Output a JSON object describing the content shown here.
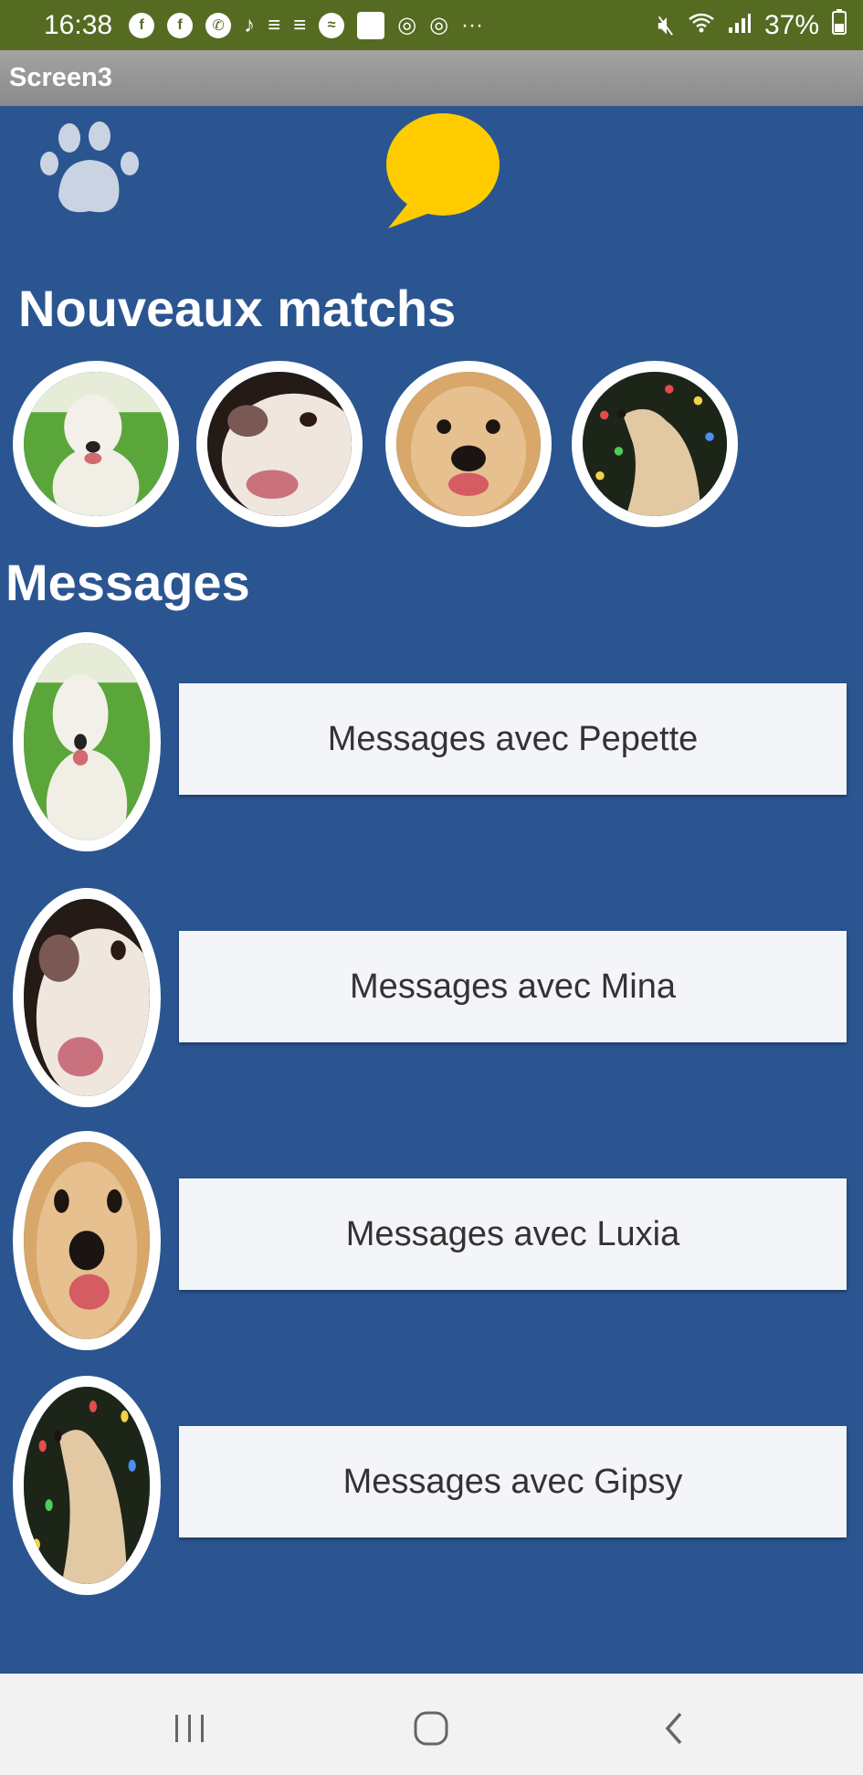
{
  "status_bar": {
    "time": "16:38",
    "more": "···",
    "battery": "37%",
    "bg_color": "#566b22"
  },
  "window": {
    "title": "Screen3"
  },
  "header": {
    "paw_icon": "paw-icon",
    "chat_icon": "speech-bubble-icon",
    "chat_color": "#ffcc00"
  },
  "matches": {
    "title": "Nouveaux matchs",
    "items": [
      {
        "name": "Pepette"
      },
      {
        "name": "Mina"
      },
      {
        "name": "Luxia"
      },
      {
        "name": "Gipsy"
      }
    ]
  },
  "messages": {
    "title": "Messages",
    "items": [
      {
        "button_label": "Messages avec Pepette"
      },
      {
        "button_label": "Messages avec Mina"
      },
      {
        "button_label": "Messages avec Luxia"
      },
      {
        "button_label": "Messages avec Gipsy"
      }
    ]
  },
  "nav": {
    "recents": "recents-icon",
    "home": "home-icon",
    "back": "back-icon"
  },
  "colors": {
    "background": "#2a5590",
    "button": "#f4f5f9"
  }
}
